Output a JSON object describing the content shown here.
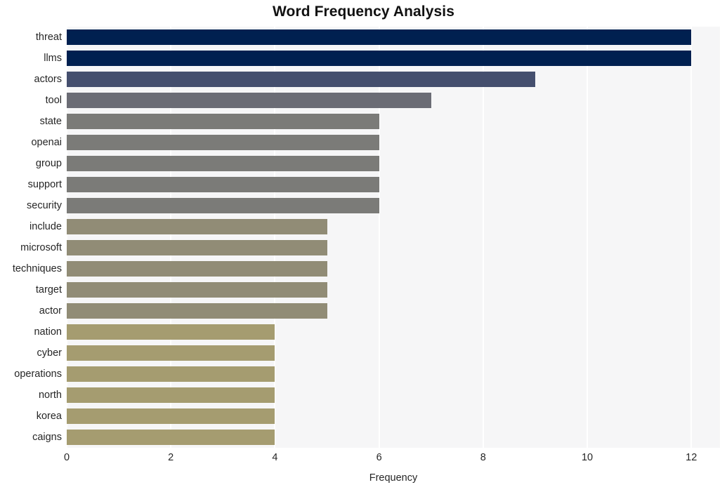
{
  "chart_data": {
    "type": "bar",
    "orientation": "horizontal",
    "title": "Word Frequency Analysis",
    "xlabel": "Frequency",
    "ylabel": "",
    "categories": [
      "threat",
      "llms",
      "actors",
      "tool",
      "state",
      "openai",
      "group",
      "support",
      "security",
      "include",
      "microsoft",
      "techniques",
      "target",
      "actor",
      "nation",
      "cyber",
      "operations",
      "north",
      "korea",
      "caigns"
    ],
    "values": [
      12,
      12,
      9,
      7,
      6,
      6,
      6,
      6,
      6,
      5,
      5,
      5,
      5,
      5,
      4,
      4,
      4,
      4,
      4,
      4
    ],
    "bar_colors": [
      "#002050",
      "#002050",
      "#454f6e",
      "#6b6c75",
      "#7b7b78",
      "#7b7b78",
      "#7b7b78",
      "#7b7b78",
      "#7b7b78",
      "#918c76",
      "#918c76",
      "#918c76",
      "#918c76",
      "#918c76",
      "#a59c70",
      "#a59c70",
      "#a59c70",
      "#a59c70",
      "#a59c70",
      "#a59c70"
    ],
    "xlim": [
      0,
      12.55
    ],
    "xticks": [
      0,
      2,
      4,
      6,
      8,
      10,
      12
    ],
    "xtick_labels": [
      "0",
      "2",
      "4",
      "6",
      "8",
      "10",
      "12"
    ],
    "grid": true,
    "grid_color": "#ffffff",
    "plot_background": "#f6f6f7",
    "figure_background": "#ffffff",
    "legend": null
  }
}
